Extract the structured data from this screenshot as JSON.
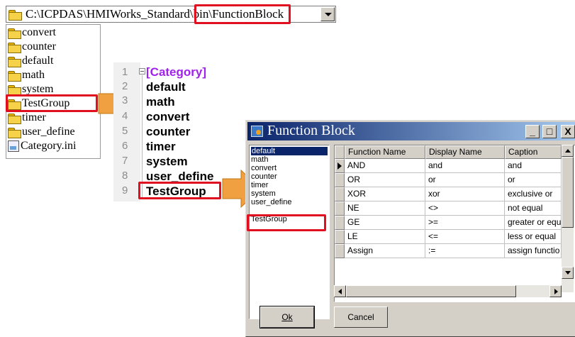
{
  "path_combo": {
    "value": "C:\\ICPDAS\\HMIWorks_Standard\\bin\\FunctionBlock"
  },
  "folder_tree": {
    "items": [
      {
        "label": "convert",
        "type": "folder"
      },
      {
        "label": "counter",
        "type": "folder"
      },
      {
        "label": "default",
        "type": "folder"
      },
      {
        "label": "math",
        "type": "folder"
      },
      {
        "label": "system",
        "type": "folder"
      },
      {
        "label": "TestGroup",
        "type": "folder"
      },
      {
        "label": "timer",
        "type": "folder"
      },
      {
        "label": "user_define",
        "type": "folder"
      },
      {
        "label": "Category.ini",
        "type": "ini-file"
      }
    ]
  },
  "category_file": {
    "line_numbers": [
      "1",
      "2",
      "3",
      "4",
      "5",
      "6",
      "7",
      "8",
      "9"
    ],
    "lines": [
      "[Category]",
      "default",
      "math",
      "convert",
      "counter",
      "timer",
      "system",
      "user_define",
      "TestGroup"
    ],
    "header_color": "#a020f0"
  },
  "dialog": {
    "title": "Function Block",
    "window_buttons": {
      "minimize": "_",
      "maximize": "□",
      "close": "X"
    },
    "categories": [
      "default",
      "math",
      "convert",
      "counter",
      "timer",
      "system",
      "user_define",
      "TestGroup"
    ],
    "selected_category": "default",
    "columns": [
      "Function Name",
      "Display Name",
      "Caption"
    ],
    "rows": [
      {
        "name": "AND",
        "display": "and",
        "caption": "and"
      },
      {
        "name": "OR",
        "display": "or",
        "caption": "or"
      },
      {
        "name": "XOR",
        "display": "xor",
        "caption": "exclusive or"
      },
      {
        "name": "NE",
        "display": "<>",
        "caption": "not equal"
      },
      {
        "name": "GE",
        "display": ">=",
        "caption": "greater or equ"
      },
      {
        "name": "LE",
        "display": "<=",
        "caption": "less or equal"
      },
      {
        "name": "Assign",
        "display": ":=",
        "caption": "assign functio"
      }
    ],
    "ok_label": "Ok",
    "cancel_label": "Cancel"
  },
  "colors": {
    "highlight_border": "#e01020",
    "arrow_fill": "#f0a040",
    "title_bar": "#0a246a",
    "selection": "#0a246a"
  }
}
